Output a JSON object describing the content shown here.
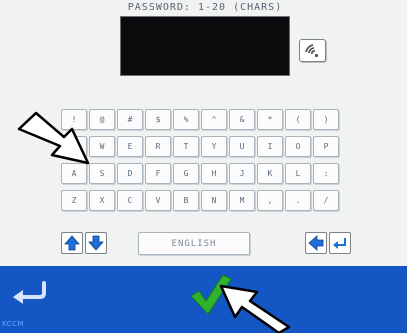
{
  "header": {
    "title": "PASSWORD: 1-20 (CHARS)"
  },
  "password_display": {
    "value": ""
  },
  "wifi_button": {
    "icon": "wifi-icon"
  },
  "keyboard": {
    "rows": [
      [
        "!",
        "@",
        "#",
        "$",
        "%",
        "^",
        "&",
        "*",
        "(",
        ")"
      ],
      [
        "Q",
        "W",
        "E",
        "R",
        "T",
        "Y",
        "U",
        "I",
        "O",
        "P"
      ],
      [
        "A",
        "S",
        "D",
        "F",
        "G",
        "H",
        "J",
        "K",
        "L",
        ":"
      ],
      [
        "Z",
        "X",
        "C",
        "V",
        "B",
        "N",
        "M",
        ",",
        ".",
        "/"
      ]
    ],
    "space_label": "ENGLISH",
    "shift_up_icon": "arrow-up-icon",
    "shift_down_icon": "arrow-down-icon",
    "backspace_icon": "arrow-left-icon",
    "enter_icon": "enter-icon"
  },
  "bottom_bar": {
    "back_icon": "back-arrow-icon",
    "confirm_icon": "checkmark-icon",
    "logo": "KCCM"
  },
  "colors": {
    "screen_bg": "#f1f3f3",
    "display_bg": "#0b0b0d",
    "bottom_bar": "#1456c4",
    "confirm_green": "#2fb32f",
    "key_text": "#5b6b80"
  }
}
